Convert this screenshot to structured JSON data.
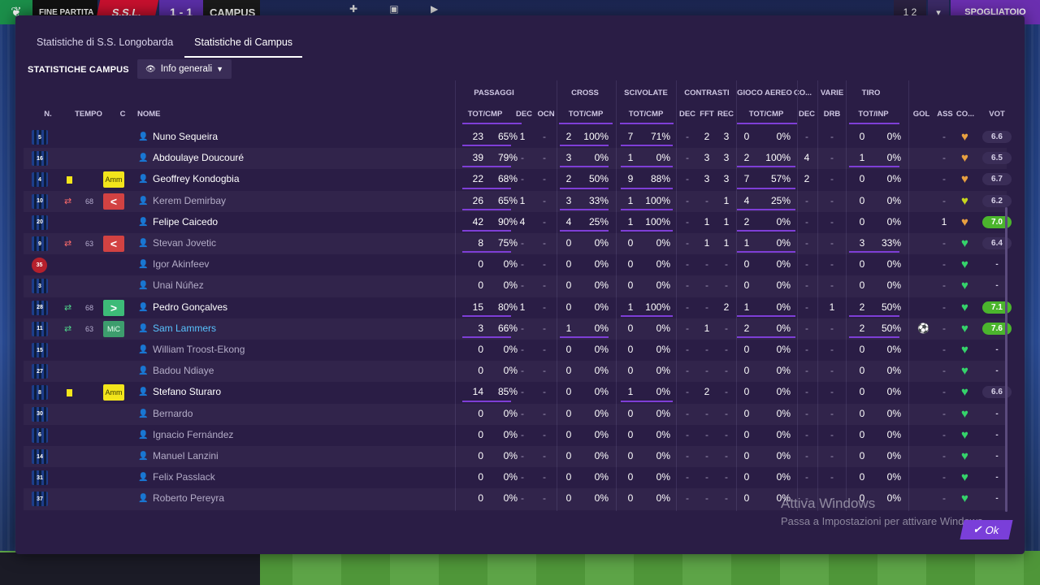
{
  "topbar": {
    "status": "FINE PARTITA",
    "home": "S.S.L.",
    "score": "1 - 1",
    "away": "CAMPUS",
    "count": "1 2",
    "action": "SPOGLIATOIO"
  },
  "tabs": [
    "Statistiche di S.S. Longobarda",
    "Statistiche di Campus"
  ],
  "section_title": "STATISTICHE CAMPUS",
  "dropdown": "Info generali",
  "headers": {
    "groups": [
      "PASSAGGI",
      "CROSS",
      "SCIVOLATE",
      "CONTRASTI",
      "GIOCO AEREO",
      "CO...",
      "VARIE",
      "TIRO"
    ],
    "fixed": [
      "N.",
      "TEMPO",
      "C",
      "NOME"
    ],
    "sub": [
      "TOT/CMP",
      "DEC",
      "OCN",
      "TOT/CMP",
      "TOT/CMP",
      "DEC",
      "FFT",
      "REC",
      "TOT/CMP",
      "DEC",
      "DRB",
      "TOT/INP",
      "GOL",
      "ASS",
      "CO...",
      "VOT"
    ]
  },
  "players": [
    {
      "n": "5",
      "name": "Nuno Sequeira",
      "pas": "23",
      "pasp": "65%",
      "pdec": "1",
      "ocn": "-",
      "cro": "2",
      "crop": "100%",
      "sci": "7",
      "scip": "71%",
      "cdec": "-",
      "fft": "2",
      "rec": "3",
      "aer": "0",
      "aerp": "0%",
      "codec": "-",
      "drb": "-",
      "tiro": "0",
      "tirop": "0%",
      "gol": "",
      "ass": "-",
      "vot": "6.6",
      "yc": false,
      "role": "",
      "subs": "",
      "min": "",
      "dim": false,
      "heart": "orange"
    },
    {
      "n": "16",
      "name": "Abdoulaye Doucouré",
      "pas": "39",
      "pasp": "79%",
      "pdec": "-",
      "ocn": "-",
      "cro": "3",
      "crop": "0%",
      "sci": "1",
      "scip": "0%",
      "cdec": "-",
      "fft": "3",
      "rec": "3",
      "aer": "2",
      "aerp": "100%",
      "codec": "4",
      "drb": "-",
      "tiro": "1",
      "tirop": "0%",
      "gol": "",
      "ass": "-",
      "vot": "6.5",
      "yc": false,
      "role": "",
      "subs": "",
      "min": "",
      "dim": false,
      "heart": "orange"
    },
    {
      "n": "4",
      "name": "Geoffrey Kondogbia",
      "pas": "22",
      "pasp": "68%",
      "pdec": "-",
      "ocn": "-",
      "cro": "2",
      "crop": "50%",
      "sci": "9",
      "scip": "88%",
      "cdec": "-",
      "fft": "3",
      "rec": "3",
      "aer": "7",
      "aerp": "57%",
      "codec": "2",
      "drb": "-",
      "tiro": "0",
      "tirop": "0%",
      "gol": "",
      "ass": "-",
      "vot": "6.7",
      "yc": true,
      "role": "Amm",
      "subs": "",
      "min": "",
      "dim": false,
      "heart": "orange"
    },
    {
      "n": "10",
      "name": "Kerem Demirbay",
      "pas": "26",
      "pasp": "65%",
      "pdec": "1",
      "ocn": "-",
      "cro": "3",
      "crop": "33%",
      "sci": "1",
      "scip": "100%",
      "cdec": "-",
      "fft": "-",
      "rec": "1",
      "aer": "4",
      "aerp": "25%",
      "codec": "-",
      "drb": "-",
      "tiro": "0",
      "tirop": "0%",
      "gol": "",
      "ass": "-",
      "vot": "6.2",
      "yc": false,
      "role": "<",
      "subs": "out",
      "min": "68",
      "dim": true,
      "heart": "yellow"
    },
    {
      "n": "20",
      "name": "Felipe Caicedo",
      "pas": "42",
      "pasp": "90%",
      "pdec": "4",
      "ocn": "-",
      "cro": "4",
      "crop": "25%",
      "sci": "1",
      "scip": "100%",
      "cdec": "-",
      "fft": "1",
      "rec": "1",
      "aer": "2",
      "aerp": "0%",
      "codec": "-",
      "drb": "-",
      "tiro": "0",
      "tirop": "0%",
      "gol": "",
      "ass": "1",
      "vot": "7.0",
      "yc": false,
      "role": "",
      "subs": "",
      "min": "",
      "dim": false,
      "heart": "orange",
      "good": true
    },
    {
      "n": "9",
      "name": "Stevan Jovetic",
      "pas": "8",
      "pasp": "75%",
      "pdec": "-",
      "ocn": "-",
      "cro": "0",
      "crop": "0%",
      "sci": "0",
      "scip": "0%",
      "cdec": "-",
      "fft": "1",
      "rec": "1",
      "aer": "1",
      "aerp": "0%",
      "codec": "-",
      "drb": "-",
      "tiro": "3",
      "tirop": "33%",
      "gol": "",
      "ass": "-",
      "vot": "6.4",
      "yc": false,
      "role": "<",
      "subs": "out",
      "min": "63",
      "dim": true,
      "heart": "green"
    },
    {
      "n": "35",
      "name": "Igor Akinfeev",
      "pas": "0",
      "pasp": "0%",
      "pdec": "-",
      "ocn": "-",
      "cro": "0",
      "crop": "0%",
      "sci": "0",
      "scip": "0%",
      "cdec": "-",
      "fft": "-",
      "rec": "-",
      "aer": "0",
      "aerp": "0%",
      "codec": "-",
      "drb": "-",
      "tiro": "0",
      "tirop": "0%",
      "gol": "",
      "ass": "-",
      "vot": "-",
      "yc": false,
      "role": "",
      "subs": "",
      "min": "",
      "dim": true,
      "heart": "green",
      "gk": true
    },
    {
      "n": "3",
      "name": "Unai Núñez",
      "pas": "0",
      "pasp": "0%",
      "pdec": "-",
      "ocn": "-",
      "cro": "0",
      "crop": "0%",
      "sci": "0",
      "scip": "0%",
      "cdec": "-",
      "fft": "-",
      "rec": "-",
      "aer": "0",
      "aerp": "0%",
      "codec": "-",
      "drb": "-",
      "tiro": "0",
      "tirop": "0%",
      "gol": "",
      "ass": "-",
      "vot": "-",
      "yc": false,
      "role": "",
      "subs": "",
      "min": "",
      "dim": true,
      "heart": "green"
    },
    {
      "n": "28",
      "name": "Pedro Gonçalves",
      "pas": "15",
      "pasp": "80%",
      "pdec": "1",
      "ocn": "-",
      "cro": "0",
      "crop": "0%",
      "sci": "1",
      "scip": "100%",
      "cdec": "-",
      "fft": "-",
      "rec": "2",
      "aer": "1",
      "aerp": "0%",
      "codec": "-",
      "drb": "1",
      "tiro": "2",
      "tirop": "50%",
      "gol": "",
      "ass": "-",
      "vot": "7.1",
      "yc": false,
      "role": ">",
      "subs": "in",
      "min": "68",
      "dim": false,
      "heart": "green",
      "good": true
    },
    {
      "n": "11",
      "name": "Sam Lammers",
      "pas": "3",
      "pasp": "66%",
      "pdec": "-",
      "ocn": "-",
      "cro": "1",
      "crop": "0%",
      "sci": "0",
      "scip": "0%",
      "cdec": "-",
      "fft": "1",
      "rec": "-",
      "aer": "2",
      "aerp": "0%",
      "codec": "-",
      "drb": "-",
      "tiro": "2",
      "tirop": "50%",
      "gol": "⚽",
      "ass": "-",
      "vot": "7.6",
      "yc": false,
      "role": "MiC",
      "subs": "in",
      "min": "63",
      "dim": false,
      "heart": "green",
      "good": true,
      "highlight": true
    },
    {
      "n": "15",
      "name": "William Troost-Ekong",
      "pas": "0",
      "pasp": "0%",
      "pdec": "-",
      "ocn": "-",
      "cro": "0",
      "crop": "0%",
      "sci": "0",
      "scip": "0%",
      "cdec": "-",
      "fft": "-",
      "rec": "-",
      "aer": "0",
      "aerp": "0%",
      "codec": "-",
      "drb": "-",
      "tiro": "0",
      "tirop": "0%",
      "gol": "",
      "ass": "-",
      "vot": "-",
      "yc": false,
      "role": "",
      "subs": "",
      "min": "",
      "dim": true,
      "heart": "green"
    },
    {
      "n": "27",
      "name": "Badou Ndiaye",
      "pas": "0",
      "pasp": "0%",
      "pdec": "-",
      "ocn": "-",
      "cro": "0",
      "crop": "0%",
      "sci": "0",
      "scip": "0%",
      "cdec": "-",
      "fft": "-",
      "rec": "-",
      "aer": "0",
      "aerp": "0%",
      "codec": "-",
      "drb": "-",
      "tiro": "0",
      "tirop": "0%",
      "gol": "",
      "ass": "-",
      "vot": "-",
      "yc": false,
      "role": "",
      "subs": "",
      "min": "",
      "dim": true,
      "heart": "green"
    },
    {
      "n": "8",
      "name": "Stefano Sturaro",
      "pas": "14",
      "pasp": "85%",
      "pdec": "-",
      "ocn": "-",
      "cro": "0",
      "crop": "0%",
      "sci": "1",
      "scip": "0%",
      "cdec": "-",
      "fft": "2",
      "rec": "-",
      "aer": "0",
      "aerp": "0%",
      "codec": "-",
      "drb": "-",
      "tiro": "0",
      "tirop": "0%",
      "gol": "",
      "ass": "-",
      "vot": "6.6",
      "yc": true,
      "role": "Amm",
      "subs": "",
      "min": "",
      "dim": false,
      "heart": "green"
    },
    {
      "n": "30",
      "name": "Bernardo",
      "pas": "0",
      "pasp": "0%",
      "pdec": "-",
      "ocn": "-",
      "cro": "0",
      "crop": "0%",
      "sci": "0",
      "scip": "0%",
      "cdec": "-",
      "fft": "-",
      "rec": "-",
      "aer": "0",
      "aerp": "0%",
      "codec": "-",
      "drb": "-",
      "tiro": "0",
      "tirop": "0%",
      "gol": "",
      "ass": "-",
      "vot": "-",
      "yc": false,
      "role": "",
      "subs": "",
      "min": "",
      "dim": true,
      "heart": "green"
    },
    {
      "n": "6",
      "name": "Ignacio Fernández",
      "pas": "0",
      "pasp": "0%",
      "pdec": "-",
      "ocn": "-",
      "cro": "0",
      "crop": "0%",
      "sci": "0",
      "scip": "0%",
      "cdec": "-",
      "fft": "-",
      "rec": "-",
      "aer": "0",
      "aerp": "0%",
      "codec": "-",
      "drb": "-",
      "tiro": "0",
      "tirop": "0%",
      "gol": "",
      "ass": "-",
      "vot": "-",
      "yc": false,
      "role": "",
      "subs": "",
      "min": "",
      "dim": true,
      "heart": "green"
    },
    {
      "n": "14",
      "name": "Manuel Lanzini",
      "pas": "0",
      "pasp": "0%",
      "pdec": "-",
      "ocn": "-",
      "cro": "0",
      "crop": "0%",
      "sci": "0",
      "scip": "0%",
      "cdec": "-",
      "fft": "-",
      "rec": "-",
      "aer": "0",
      "aerp": "0%",
      "codec": "-",
      "drb": "-",
      "tiro": "0",
      "tirop": "0%",
      "gol": "",
      "ass": "-",
      "vot": "-",
      "yc": false,
      "role": "",
      "subs": "",
      "min": "",
      "dim": true,
      "heart": "green"
    },
    {
      "n": "31",
      "name": "Felix Passlack",
      "pas": "0",
      "pasp": "0%",
      "pdec": "-",
      "ocn": "-",
      "cro": "0",
      "crop": "0%",
      "sci": "0",
      "scip": "0%",
      "cdec": "-",
      "fft": "-",
      "rec": "-",
      "aer": "0",
      "aerp": "0%",
      "codec": "-",
      "drb": "-",
      "tiro": "0",
      "tirop": "0%",
      "gol": "",
      "ass": "-",
      "vot": "-",
      "yc": false,
      "role": "",
      "subs": "",
      "min": "",
      "dim": true,
      "heart": "green"
    },
    {
      "n": "37",
      "name": "Roberto Pereyra",
      "pas": "0",
      "pasp": "0%",
      "pdec": "-",
      "ocn": "-",
      "cro": "0",
      "crop": "0%",
      "sci": "0",
      "scip": "0%",
      "cdec": "-",
      "fft": "-",
      "rec": "-",
      "aer": "0",
      "aerp": "0%",
      "codec": "-",
      "drb": "-",
      "tiro": "0",
      "tirop": "0%",
      "gol": "",
      "ass": "-",
      "vot": "-",
      "yc": false,
      "role": "",
      "subs": "",
      "min": "",
      "dim": true,
      "heart": "green"
    }
  ],
  "watermark": {
    "line1": "Attiva Windows",
    "line2": "Passa a Impostazioni per attivare Windows."
  },
  "ok_button": "Ok",
  "colors": {
    "accent": "#7e3ed6",
    "dialog_bg": "#2a1d45",
    "good_rating": "#4bb52d",
    "yellow_card": "#f3e51b"
  }
}
